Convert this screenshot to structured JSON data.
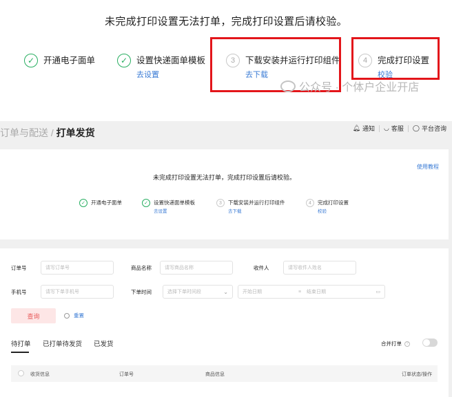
{
  "banner": {
    "notice": "未完成打印设置无法打单，完成打印设置后请校验。",
    "steps": [
      {
        "label": "开通电子面单",
        "link": "",
        "done": true,
        "num": ""
      },
      {
        "label": "设置快递面单模板",
        "link": "去设置",
        "done": true,
        "num": ""
      },
      {
        "label": "下载安装并运行打印组件",
        "link": "去下载",
        "done": false,
        "num": "3"
      },
      {
        "label": "完成打印设置",
        "link": "校验",
        "done": false,
        "num": "4"
      }
    ],
    "watermark": "公众号 · 个体户企业开店",
    "highlight_color": "#e3151a"
  },
  "breadcrumb": {
    "parent": "订单与配送",
    "separator": "/",
    "current": "打单发货"
  },
  "header_actions": [
    {
      "icon": "bell-icon",
      "label": "通知"
    },
    {
      "icon": "headset-icon",
      "label": "客服"
    },
    {
      "icon": "chat-icon",
      "label": "平台咨询"
    }
  ],
  "setup_card": {
    "tutorial_link": "使用教程",
    "notice": "未完成打印设置无法打单，完成打印设置后请校验。",
    "steps": [
      {
        "label": "开通电子面单",
        "link": "",
        "done": true,
        "num": ""
      },
      {
        "label": "设置快递面单模板",
        "link": "去设置",
        "done": true,
        "num": ""
      },
      {
        "label": "下载安装并运行打印组件",
        "link": "去下载",
        "done": false,
        "num": "3"
      },
      {
        "label": "完成打印设置",
        "link": "校验",
        "done": false,
        "num": "4"
      }
    ]
  },
  "filters": {
    "order_no": {
      "label": "订单号",
      "placeholder": "请写订单号"
    },
    "product_name": {
      "label": "商品名称",
      "placeholder": "请写商品名称"
    },
    "receiver": {
      "label": "收件人",
      "placeholder": "请写收件人姓名"
    },
    "phone": {
      "label": "手机号",
      "placeholder": "请写下单手机号"
    },
    "order_time": {
      "label": "下单时间",
      "select_placeholder": "选择下单时间段",
      "start": "开始日期",
      "end": "结束日期"
    },
    "query_button": "查询",
    "reset_button": "重置"
  },
  "tabs": [
    "待打单",
    "已打单待发货",
    "已发货"
  ],
  "merge_toggle": {
    "label": "合并打单",
    "on": false
  },
  "table_headers": [
    "收货信息",
    "订单号",
    "商品信息",
    "订单状态/操作"
  ],
  "colors": {
    "accent_green": "#27ae60",
    "link_blue": "#3a7bd5",
    "query_bg": "#fde6e6",
    "query_text": "#e85a5a"
  }
}
